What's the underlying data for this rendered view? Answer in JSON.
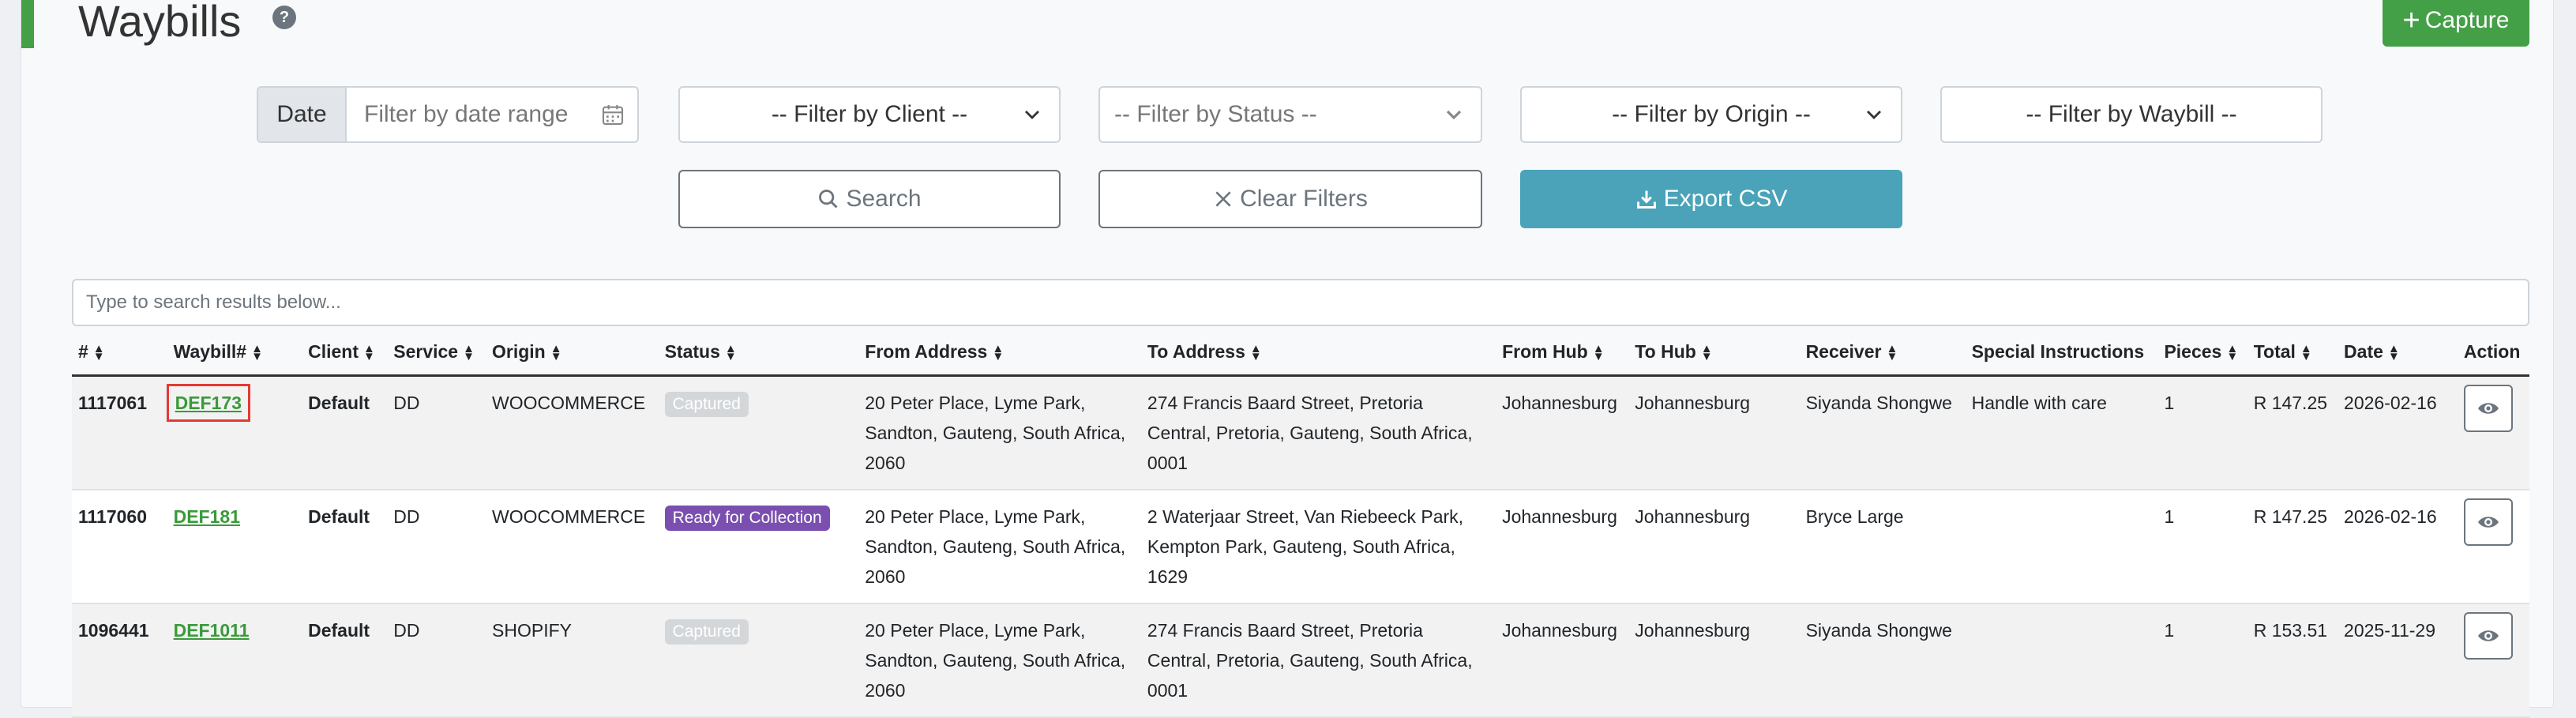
{
  "header": {
    "title": "Waybills",
    "help_icon": "?",
    "capture_label": "Capture",
    "accent_color": "#43a047"
  },
  "filters": {
    "date_label": "Date",
    "date_placeholder": "Filter by date range",
    "client": "-- Filter by Client --",
    "status": "-- Filter by Status --",
    "origin": "-- Filter by Origin --",
    "waybill": "-- Filter by Waybill --"
  },
  "actions": {
    "search": "Search",
    "clear": "Clear Filters",
    "export": "Export CSV",
    "export_color": "#4aa3b8"
  },
  "table_search_placeholder": "Type to search results below...",
  "table": {
    "columns": [
      "#",
      "Waybill#",
      "Client",
      "Service",
      "Origin",
      "Status",
      "From Address",
      "To Address",
      "From Hub",
      "To Hub",
      "Receiver",
      "Special Instructions",
      "Pieces",
      "Total",
      "Date",
      "Action"
    ],
    "rows": [
      {
        "id": "1117061",
        "waybill": "DEF173",
        "client": "Default",
        "service": "DD",
        "origin": "WOOCOMMERCE",
        "status": "Captured",
        "status_color": "#d4d7da",
        "from": "20 Peter Place, Lyme Park, Sandton, Gauteng, South Africa, 2060",
        "to": "274 Francis Baard Street, Pretoria Central, Pretoria, Gauteng, South Africa, 0001",
        "from_hub": "Johannesburg",
        "to_hub": "Johannesburg",
        "receiver": "Siyanda Shongwe",
        "instructions": "Handle with care",
        "pieces": "1",
        "total": "R 147.25",
        "date": "2026-02-16"
      },
      {
        "id": "1117060",
        "waybill": "DEF181",
        "client": "Default",
        "service": "DD",
        "origin": "WOOCOMMERCE",
        "status": "Ready for Collection",
        "status_color": "#7a4fb0",
        "from": "20 Peter Place, Lyme Park, Sandton, Gauteng, South Africa, 2060",
        "to": "2 Waterjaar Street, Van Riebeeck Park, Kempton Park, Gauteng, South Africa, 1629",
        "from_hub": "Johannesburg",
        "to_hub": "Johannesburg",
        "receiver": "Bryce Large",
        "instructions": "",
        "pieces": "1",
        "total": "R 147.25",
        "date": "2026-02-16"
      },
      {
        "id": "1096441",
        "waybill": "DEF1011",
        "client": "Default",
        "service": "DD",
        "origin": "SHOPIFY",
        "status": "Captured",
        "status_color": "#d4d7da",
        "from": "20 Peter Place, Lyme Park, Sandton, Gauteng, South Africa, 2060",
        "to": "274 Francis Baard Street, Pretoria Central, Pretoria, Gauteng, South Africa, 0001",
        "from_hub": "Johannesburg",
        "to_hub": "Johannesburg",
        "receiver": "Siyanda Shongwe",
        "instructions": "",
        "pieces": "1",
        "total": "R 153.51",
        "date": "2025-11-29"
      }
    ]
  }
}
